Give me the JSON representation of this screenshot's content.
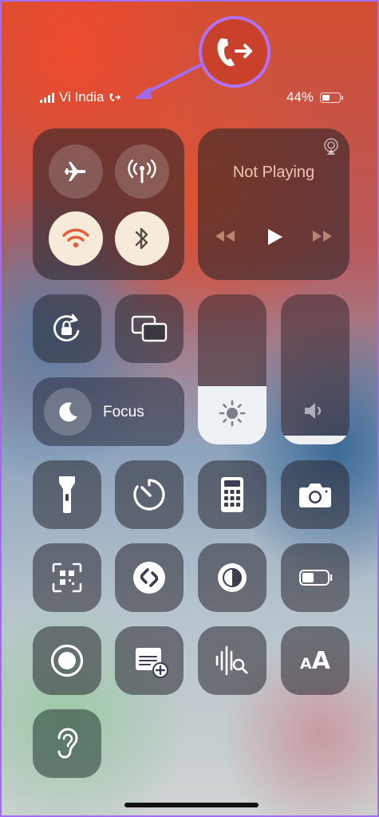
{
  "status_bar": {
    "carrier": "Vi India",
    "battery_percent": "44%",
    "signal_bars": 4,
    "battery_level": 0.44
  },
  "connectivity": {
    "airplane": {
      "icon": "airplane-icon",
      "on": false
    },
    "cellular": {
      "icon": "cellular-antenna-icon",
      "on": false
    },
    "wifi": {
      "icon": "wifi-icon",
      "on": true
    },
    "bluetooth": {
      "icon": "bluetooth-icon",
      "on": true
    }
  },
  "now_playing": {
    "title": "Not Playing",
    "airplay_icon": "airplay-icon",
    "controls": [
      "rewind-icon",
      "play-icon",
      "fast-forward-icon"
    ]
  },
  "focus": {
    "label": "Focus",
    "icon": "moon-icon"
  },
  "brightness": {
    "icon": "sun-icon",
    "level": 0.39
  },
  "volume": {
    "icon": "speaker-icon",
    "level": 0.06
  },
  "colors": {
    "accent_purple": "#a36cf0",
    "callout_red": "#c9412b",
    "lit_tile": "#f6ead9",
    "wifi_orange": "#e8603a"
  },
  "shortcuts": [
    "screen-rotation-lock-icon",
    "screen-mirroring-icon",
    "flashlight-icon",
    "timer-icon",
    "calculator-icon",
    "camera-icon",
    "qr-code-scanner-icon",
    "shazam-icon",
    "dark-mode-icon",
    "low-power-mode-icon",
    "screen-recording-icon",
    "quick-note-icon",
    "sound-recognition-icon",
    "text-size-icon",
    "hearing-icon"
  ],
  "text_size_label": "AA"
}
